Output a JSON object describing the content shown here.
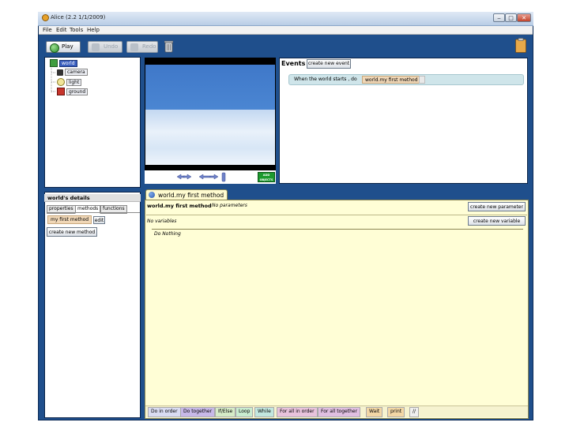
{
  "window": {
    "title": "Alice (2.2 1/1/2009)",
    "minimize": "‒",
    "maximize": "□",
    "close": "✕"
  },
  "menu": [
    "File",
    "Edit",
    "Tools",
    "Help"
  ],
  "toolbar": {
    "play": "Play",
    "undo": "Undo",
    "redo": "Redo"
  },
  "scene_tree": {
    "root": "world",
    "children": [
      "camera",
      "light",
      "ground"
    ]
  },
  "world_view": {
    "add_objects": "ADD OBJECTS"
  },
  "events": {
    "title": "Events",
    "create_button": "create new event",
    "rule": {
      "when": "When the world starts , do",
      "method": "world.my first method"
    }
  },
  "details": {
    "title": "world's details",
    "tabs": [
      "properties",
      "methods",
      "functions"
    ],
    "method_name": "my first method",
    "edit_button": "edit",
    "create_method_button": "create new method"
  },
  "editor": {
    "tab_title": "world.my first method",
    "method_name": "world.my first method",
    "params": "No parameters",
    "variables": "No variables",
    "body": "Do Nothing",
    "create_param_button": "create new parameter",
    "create_var_button": "create new variable"
  },
  "palette": [
    {
      "label": "Do in order",
      "color": "#d9dcf2"
    },
    {
      "label": "Do together",
      "color": "#c7b9e8"
    },
    {
      "label": "If/Else",
      "color": "#d5ebc7"
    },
    {
      "label": "Loop",
      "color": "#c9ecd0"
    },
    {
      "label": "While",
      "color": "#c2e7df"
    },
    {
      "label": "For all in order",
      "color": "#e8c3dc"
    },
    {
      "label": "For all together",
      "color": "#e0bfe1"
    },
    {
      "label": "Wait",
      "color": "#f2d7a6"
    },
    {
      "label": "print",
      "color": "#f2d7a6"
    },
    {
      "label": "//",
      "color": "#f0f0f0"
    }
  ]
}
